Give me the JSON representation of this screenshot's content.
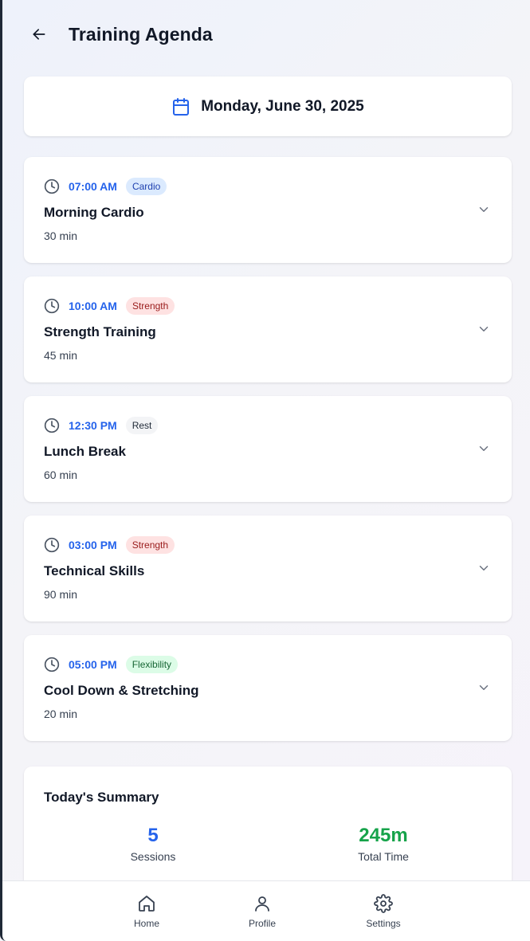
{
  "header": {
    "title": "Training Agenda"
  },
  "date": {
    "label": "Monday, June 30, 2025"
  },
  "sessions": [
    {
      "time": "07:00 AM",
      "tag": "Cardio",
      "tag_bg": "#dbeafe",
      "tag_fg": "#1e40af",
      "name": "Morning Cardio",
      "duration": "30 min"
    },
    {
      "time": "10:00 AM",
      "tag": "Strength",
      "tag_bg": "#fee2e2",
      "tag_fg": "#991b1b",
      "name": "Strength Training",
      "duration": "45 min"
    },
    {
      "time": "12:30 PM",
      "tag": "Rest",
      "tag_bg": "#f3f4f6",
      "tag_fg": "#1f2937",
      "name": "Lunch Break",
      "duration": "60 min"
    },
    {
      "time": "03:00 PM",
      "tag": "Strength",
      "tag_bg": "#fee2e2",
      "tag_fg": "#991b1b",
      "name": "Technical Skills",
      "duration": "90 min"
    },
    {
      "time": "05:00 PM",
      "tag": "Flexibility",
      "tag_bg": "#dcfce7",
      "tag_fg": "#166534",
      "name": "Cool Down & Stretching",
      "duration": "20 min"
    }
  ],
  "summary": {
    "title": "Today's Summary",
    "sessions_value": "5",
    "sessions_label": "Sessions",
    "sessions_color": "#2563eb",
    "time_value": "245m",
    "time_label": "Total Time",
    "time_color": "#16a34a"
  },
  "nav": {
    "home": "Home",
    "profile": "Profile",
    "settings": "Settings"
  },
  "colors": {
    "accent": "#2563eb"
  }
}
